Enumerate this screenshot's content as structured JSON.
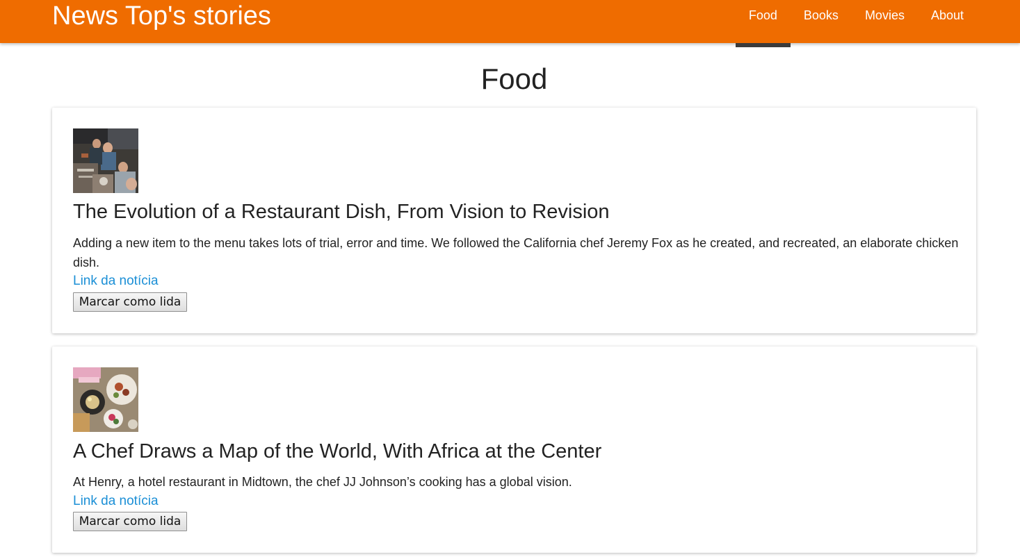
{
  "header": {
    "brand": "News Top's stories",
    "nav": [
      {
        "label": "Food",
        "active": true
      },
      {
        "label": "Books",
        "active": false
      },
      {
        "label": "Movies",
        "active": false
      },
      {
        "label": "About",
        "active": false
      }
    ]
  },
  "page": {
    "title": "Food"
  },
  "articles": [
    {
      "title": "The Evolution of a Restaurant Dish, From Vision to Revision",
      "abstract": "Adding a new item to the menu takes lots of trial, error and time. We followed the California chef Jeremy Fox as he created, and recreated, an elaborate chicken dish.",
      "link_label": "Link da notícia",
      "button_label": "Marcar como lida"
    },
    {
      "title": "A Chef Draws a Map of the World, With Africa at the Center",
      "abstract": "At Henry, a hotel restaurant in Midtown, the chef JJ Johnson’s cooking has a global vision.",
      "link_label": "Link da notícia",
      "button_label": "Marcar como lida"
    }
  ],
  "colors": {
    "header_bg": "#ef6c00",
    "active_indicator": "#3b3b3b",
    "link": "#1b8fd6"
  }
}
